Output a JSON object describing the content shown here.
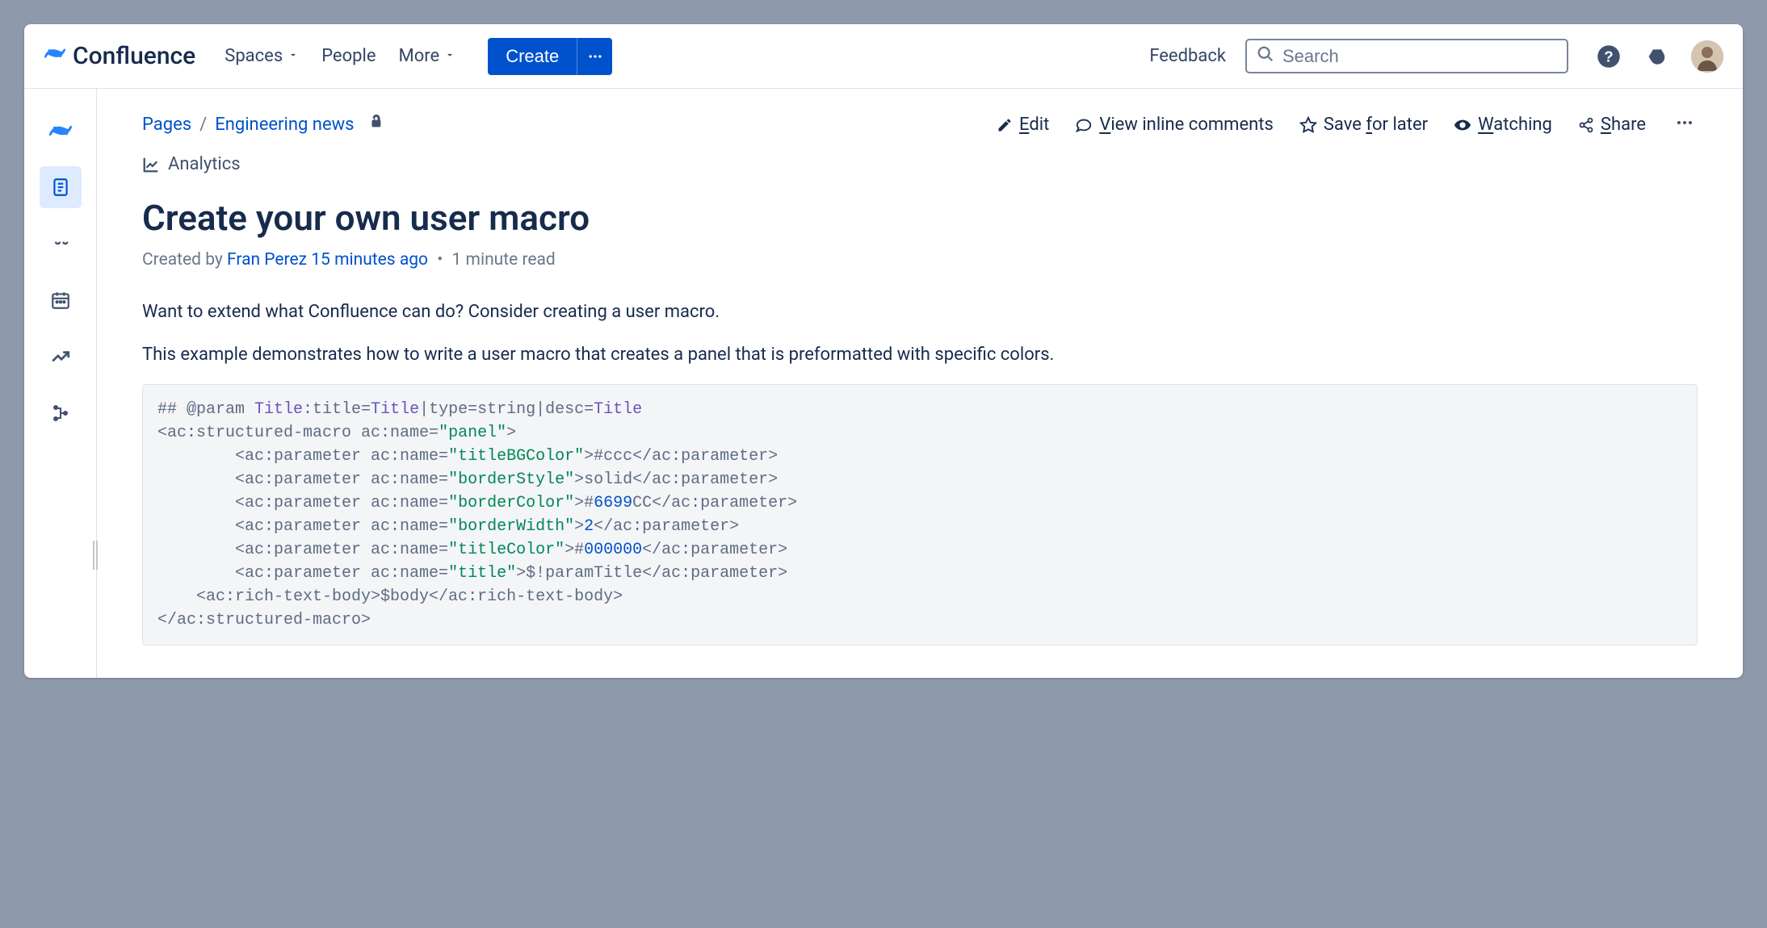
{
  "brand": "Confluence",
  "nav": {
    "spaces": "Spaces",
    "people": "People",
    "more": "More",
    "create": "Create",
    "feedback": "Feedback",
    "search_placeholder": "Search"
  },
  "breadcrumb": {
    "pages": "Pages",
    "space": "Engineering news"
  },
  "actions": {
    "edit": "Edit",
    "edit_rest": "dit",
    "view": "View inline comments",
    "view_rest": "iew inline comments",
    "save": "Save for later",
    "save_pre": "Save ",
    "save_rest": "or later",
    "watch": "Watching",
    "watch_rest": "atching",
    "share": "Share",
    "share_rest": "hare",
    "analytics": "Analytics"
  },
  "page": {
    "title": "Create your own user macro",
    "created_by_prefix": "Created by ",
    "author": "Fran Perez",
    "timestamp": " 15 minutes ago",
    "read_time": "1 minute read",
    "para1": "Want to extend what Confluence can do? Consider creating a user macro.",
    "para2": "This example demonstrates how to write a user macro that creates a panel that is preformatted with specific colors."
  },
  "code": {
    "l1a": "## @param ",
    "l1b": "Title",
    "l1c": ":title=",
    "l1d": "Title",
    "l1e": "|type=string|desc=",
    "l1f": "Title",
    "l2a": "<ac:structured-macro ac:name=",
    "l2b": "\"panel\"",
    "l2c": ">",
    "l3a": "        <ac:parameter ac:name=",
    "l3b": "\"titleBGColor\"",
    "l3c": ">#ccc</ac:parameter>",
    "l4a": "        <ac:parameter ac:name=",
    "l4b": "\"borderStyle\"",
    "l4c": ">solid</ac:parameter>",
    "l5a": "        <ac:parameter ac:name=",
    "l5b": "\"borderColor\"",
    "l5c": ">#",
    "l5d": "6699",
    "l5e": "CC</ac:parameter>",
    "l6a": "        <ac:parameter ac:name=",
    "l6b": "\"borderWidth\"",
    "l6c": ">",
    "l6d": "2",
    "l6e": "</ac:parameter>",
    "l7a": "        <ac:parameter ac:name=",
    "l7b": "\"titleColor\"",
    "l7c": ">#",
    "l7d": "000000",
    "l7e": "</ac:parameter>",
    "l8a": "        <ac:parameter ac:name=",
    "l8b": "\"title\"",
    "l8c": ">$!paramTitle</ac:parameter>",
    "l9": "    <ac:rich-text-body>$body</ac:rich-text-body>",
    "l10": "</ac:structured-macro>"
  }
}
